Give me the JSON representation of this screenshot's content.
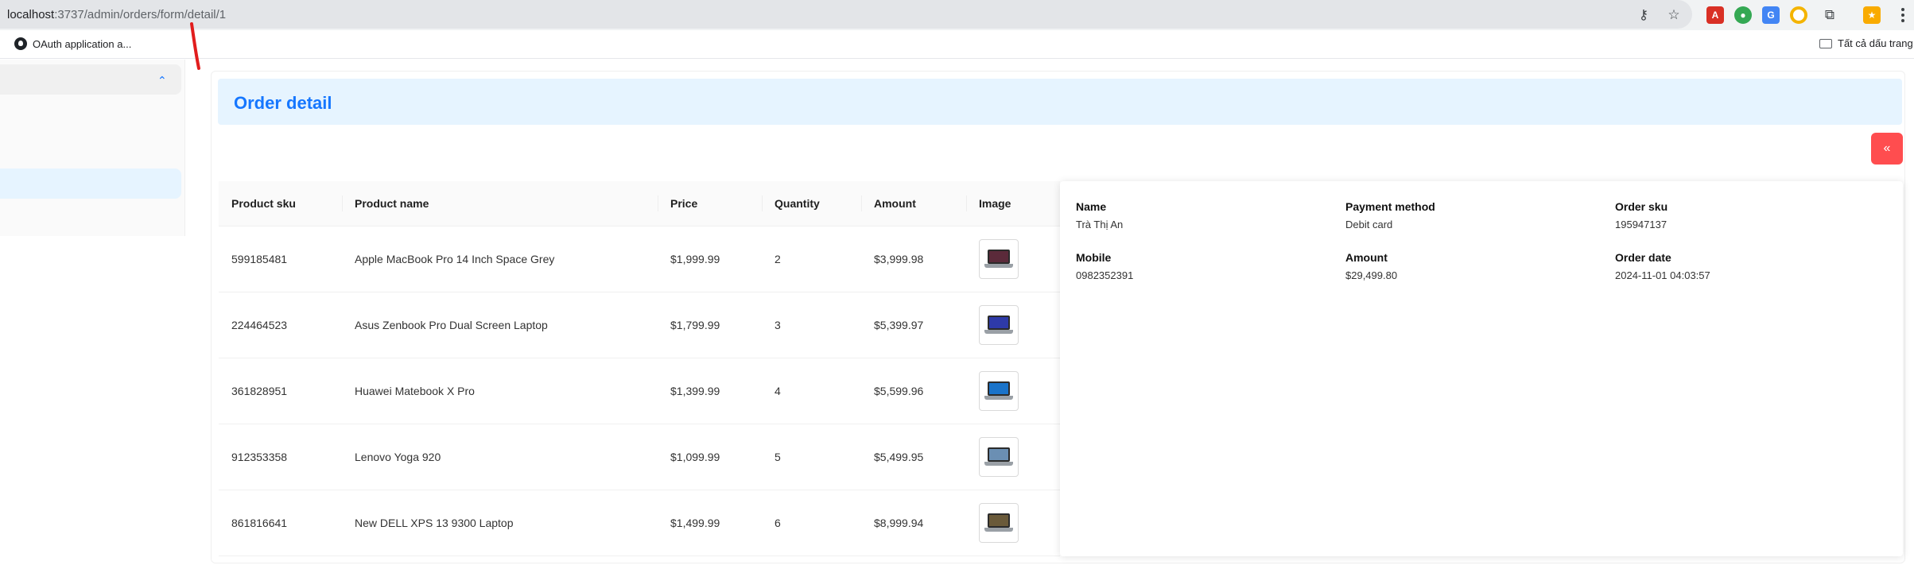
{
  "browser": {
    "url_host": "localhost",
    "url_path": ":3737/admin/orders/form/detail/1",
    "bookmarks": [
      {
        "label": "OAuth application a..."
      }
    ],
    "bookmarks_folder": "Tất cả dấu trang",
    "icons": [
      "key-icon",
      "star-icon",
      "extension-pdf-icon",
      "extension-color-icon",
      "extension-translate-icon",
      "extension-circle-icon",
      "puzzle-icon",
      "profile-icon",
      "menu-icon"
    ]
  },
  "page": {
    "title": "Order detail",
    "back_button_icon": "double-chevron-left-icon",
    "accent_color": "#1677ff",
    "danger_color": "#ff4d4f"
  },
  "table": {
    "columns": [
      "Product sku",
      "Product name",
      "Price",
      "Quantity",
      "Amount",
      "Image"
    ],
    "rows": [
      {
        "sku": "599185481",
        "name": "Apple MacBook Pro 14 Inch Space Grey",
        "price": "$1,999.99",
        "quantity": "2",
        "amount": "$3,999.98",
        "image": "laptop-icon"
      },
      {
        "sku": "224464523",
        "name": "Asus Zenbook Pro Dual Screen Laptop",
        "price": "$1,799.99",
        "quantity": "3",
        "amount": "$5,399.97",
        "image": "laptop-icon"
      },
      {
        "sku": "361828951",
        "name": "Huawei Matebook X Pro",
        "price": "$1,399.99",
        "quantity": "4",
        "amount": "$5,599.96",
        "image": "laptop-icon"
      },
      {
        "sku": "912353358",
        "name": "Lenovo Yoga 920",
        "price": "$1,099.99",
        "quantity": "5",
        "amount": "$5,499.95",
        "image": "laptop-icon"
      },
      {
        "sku": "861816641",
        "name": "New DELL XPS 13 9300 Laptop",
        "price": "$1,499.99",
        "quantity": "6",
        "amount": "$8,999.94",
        "image": "laptop-icon"
      }
    ]
  },
  "order_info": {
    "name_label": "Name",
    "name_value": "Trà Thị An",
    "payment_label": "Payment method",
    "payment_value": "Debit card",
    "sku_label": "Order sku",
    "sku_value": "195947137",
    "mobile_label": "Mobile",
    "mobile_value": "0982352391",
    "amount_label": "Amount",
    "amount_value": "$29,499.80",
    "date_label": "Order date",
    "date_value": "2024-11-01 04:03:57"
  }
}
